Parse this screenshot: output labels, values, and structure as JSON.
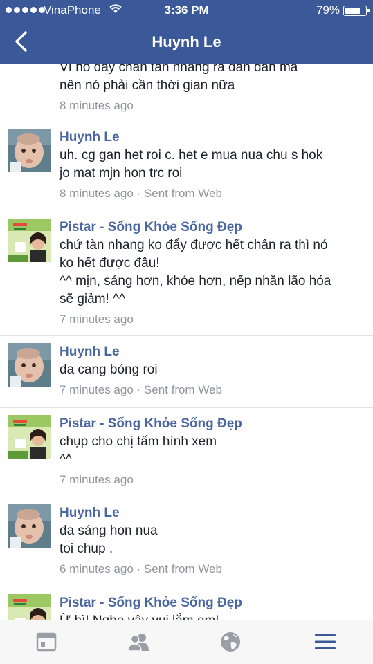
{
  "status_bar": {
    "carrier": "VinaPhone",
    "time": "3:36 PM",
    "battery_percent": "79%",
    "battery_level": 0.79
  },
  "header": {
    "title": "Huynh Le",
    "back_icon": "chevron-left-icon"
  },
  "messages": [
    {
      "author": "",
      "lines": [
        "Vì nó đẩy chân tàn nhang ra dần dần mà",
        "nên nó phải cần thời gian nữa"
      ],
      "meta": "8 minutes ago"
    },
    {
      "author": "Huynh Le",
      "lines": [
        "uh. cg gan het roi c. het e mua nua chu s hok",
        "jo mat mjn hon trc roi"
      ],
      "meta": "8 minutes ago · Sent from Web"
    },
    {
      "author": "Pistar - Sống Khỏe Sống Đẹp",
      "lines": [
        "chứ tàn nhang ko đẩy được hết chân ra thì nó",
        "ko hết được đâu!",
        "^^ mịn, sáng hơn, khỏe hơn, nếp nhăn lão hóa",
        "sẽ giảm! ^^"
      ],
      "meta": "7 minutes ago"
    },
    {
      "author": "Huynh Le",
      "lines": [
        "da cang bóng roi"
      ],
      "meta": "7 minutes ago · Sent from Web"
    },
    {
      "author": "Pistar - Sống Khỏe Sống Đẹp",
      "lines": [
        "chụp cho chị tấm hình xem",
        "^^"
      ],
      "meta": "7 minutes ago"
    },
    {
      "author": "Huynh Le",
      "lines": [
        "da sáng hon nua",
        "toi chup ."
      ],
      "meta": "6 minutes ago · Sent from Web"
    },
    {
      "author": "Pistar - Sống Khỏe Sống Đẹp",
      "lines": [
        "Ừ hì! Nghe vậy vui lắm em!"
      ],
      "meta": ""
    }
  ],
  "tabbar": {
    "icons": [
      "news-feed-icon",
      "friends-icon",
      "globe-icon",
      "menu-icon"
    ],
    "active_color": "#3b5998",
    "inactive_color": "#9a9ea7"
  },
  "colors": {
    "header_bg": "#3b5998",
    "author_name": "#4b67a1",
    "meta_text": "#90949c"
  }
}
